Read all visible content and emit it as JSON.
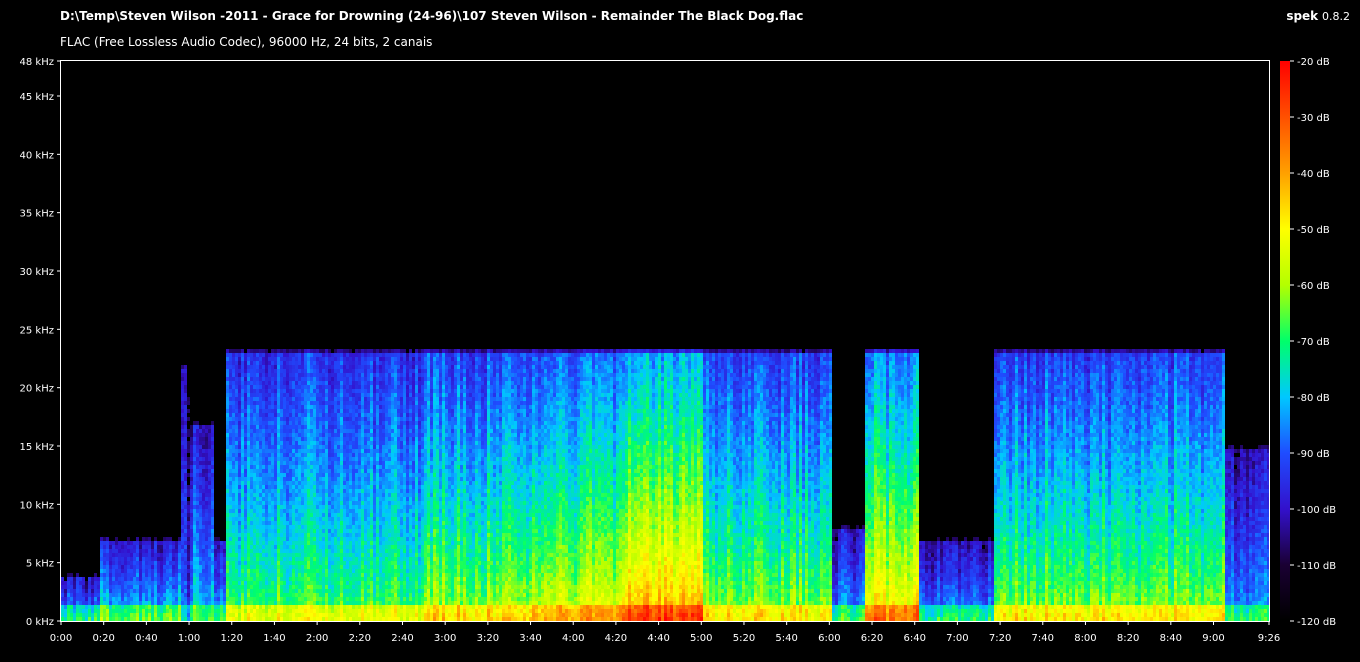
{
  "header": {
    "file_path": "D:\\Temp\\Steven Wilson -2011 - Grace for Drowning (24-96)\\107 Steven Wilson - Remainder The Black Dog.flac",
    "codec_info": "FLAC (Free Lossless Audio Codec), 96000 Hz, 24 bits, 2 canais",
    "app_name": "spek",
    "app_version": "0.8.2"
  },
  "chart_data": {
    "type": "heatmap",
    "title": "",
    "xlabel": "",
    "ylabel": "",
    "x_unit": "time",
    "y_unit": "kHz",
    "xlim": [
      0,
      566
    ],
    "ylim": [
      0,
      48
    ],
    "zlim": [
      -120,
      -20
    ],
    "x_ticks": [
      {
        "value": 0,
        "label": "0:00"
      },
      {
        "value": 20,
        "label": "0:20"
      },
      {
        "value": 40,
        "label": "0:40"
      },
      {
        "value": 60,
        "label": "1:00"
      },
      {
        "value": 80,
        "label": "1:20"
      },
      {
        "value": 100,
        "label": "1:40"
      },
      {
        "value": 120,
        "label": "2:00"
      },
      {
        "value": 140,
        "label": "2:20"
      },
      {
        "value": 160,
        "label": "2:40"
      },
      {
        "value": 180,
        "label": "3:00"
      },
      {
        "value": 200,
        "label": "3:20"
      },
      {
        "value": 220,
        "label": "3:40"
      },
      {
        "value": 240,
        "label": "4:00"
      },
      {
        "value": 260,
        "label": "4:20"
      },
      {
        "value": 280,
        "label": "4:40"
      },
      {
        "value": 300,
        "label": "5:00"
      },
      {
        "value": 320,
        "label": "5:20"
      },
      {
        "value": 340,
        "label": "5:40"
      },
      {
        "value": 360,
        "label": "6:00"
      },
      {
        "value": 380,
        "label": "6:20"
      },
      {
        "value": 400,
        "label": "6:40"
      },
      {
        "value": 420,
        "label": "7:00"
      },
      {
        "value": 440,
        "label": "7:20"
      },
      {
        "value": 460,
        "label": "7:40"
      },
      {
        "value": 480,
        "label": "8:00"
      },
      {
        "value": 500,
        "label": "8:20"
      },
      {
        "value": 520,
        "label": "8:40"
      },
      {
        "value": 540,
        "label": "9:00"
      },
      {
        "value": 566,
        "label": "9:26"
      }
    ],
    "y_ticks": [
      {
        "value": 0,
        "label": "0 kHz"
      },
      {
        "value": 5,
        "label": "5 kHz"
      },
      {
        "value": 10,
        "label": "10 kHz"
      },
      {
        "value": 15,
        "label": "15 kHz"
      },
      {
        "value": 20,
        "label": "20 kHz"
      },
      {
        "value": 25,
        "label": "25 kHz"
      },
      {
        "value": 30,
        "label": "30 kHz"
      },
      {
        "value": 35,
        "label": "35 kHz"
      },
      {
        "value": 40,
        "label": "40 kHz"
      },
      {
        "value": 45,
        "label": "45 kHz"
      },
      {
        "value": 48,
        "label": "48 kHz"
      }
    ],
    "colorbar_ticks": [
      {
        "value": -20,
        "label": "-20 dB"
      },
      {
        "value": -30,
        "label": "-30 dB"
      },
      {
        "value": -40,
        "label": "-40 dB"
      },
      {
        "value": -50,
        "label": "-50 dB"
      },
      {
        "value": -60,
        "label": "-60 dB"
      },
      {
        "value": -70,
        "label": "-70 dB"
      },
      {
        "value": -80,
        "label": "-80 dB"
      },
      {
        "value": -90,
        "label": "-90 dB"
      },
      {
        "value": -100,
        "label": "-100 dB"
      },
      {
        "value": -110,
        "label": "-110 dB"
      },
      {
        "value": -120,
        "label": "-120 dB"
      }
    ],
    "colormap": [
      "#000000",
      "#1a0033",
      "#3311cc",
      "#1f4dff",
      "#00c8ff",
      "#00ff6a",
      "#b4ff00",
      "#ffff00",
      "#ffa000",
      "#ff5000",
      "#ff0000"
    ],
    "segments": [
      {
        "t0": 0,
        "t1": 18,
        "cutoff_khz": 4,
        "level": 0.42
      },
      {
        "t0": 18,
        "t1": 55,
        "cutoff_khz": 7,
        "level": 0.48
      },
      {
        "t0": 55,
        "t1": 60,
        "cutoff_khz": 22,
        "level": 0.3
      },
      {
        "t0": 60,
        "t1": 71,
        "cutoff_khz": 17,
        "level": 0.46
      },
      {
        "t0": 71,
        "t1": 76,
        "cutoff_khz": 7,
        "level": 0.42
      },
      {
        "t0": 76,
        "t1": 170,
        "cutoff_khz": 23,
        "level": 0.58
      },
      {
        "t0": 170,
        "t1": 218,
        "cutoff_khz": 23,
        "level": 0.64
      },
      {
        "t0": 218,
        "t1": 262,
        "cutoff_khz": 23,
        "level": 0.7
      },
      {
        "t0": 262,
        "t1": 300,
        "cutoff_khz": 23,
        "level": 0.82
      },
      {
        "t0": 300,
        "t1": 360,
        "cutoff_khz": 23,
        "level": 0.62
      },
      {
        "t0": 360,
        "t1": 376,
        "cutoff_khz": 8,
        "level": 0.42
      },
      {
        "t0": 376,
        "t1": 402,
        "cutoff_khz": 23,
        "level": 0.76
      },
      {
        "t0": 402,
        "t1": 437,
        "cutoff_khz": 7,
        "level": 0.4
      },
      {
        "t0": 437,
        "t1": 545,
        "cutoff_khz": 23,
        "level": 0.62
      },
      {
        "t0": 545,
        "t1": 566,
        "cutoff_khz": 15,
        "level": 0.4
      }
    ]
  }
}
